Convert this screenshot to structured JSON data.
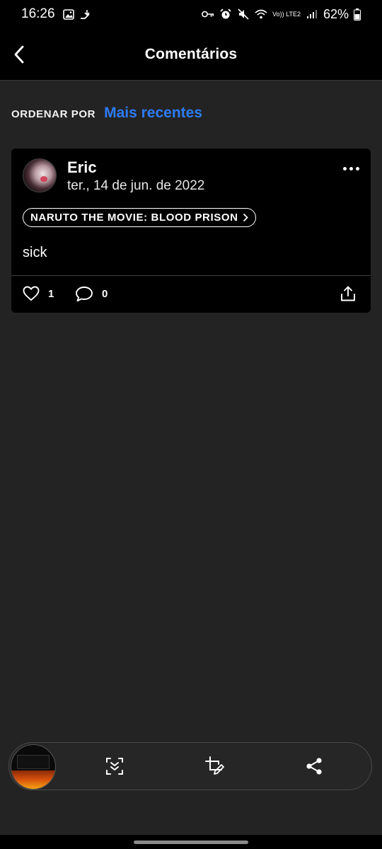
{
  "status_bar": {
    "time": "16:26",
    "battery_text": "62%",
    "network_text": "Vo)) LTE2",
    "left_icons": [
      "gallery-icon",
      "data-transfer-icon"
    ],
    "right_icons": [
      "key-icon",
      "alarm-icon",
      "mute-icon",
      "wifi-icon",
      "signal-icon",
      "battery-icon"
    ]
  },
  "header": {
    "title": "Comentários",
    "back_icon": "chevron-left-icon"
  },
  "sort": {
    "label": "ORDENAR POR",
    "value": "Mais recentes",
    "accent_color": "#2d7cf6"
  },
  "comment": {
    "author": "Eric",
    "date": "ter., 14 de jun. de 2022",
    "title_chip": "NARUTO THE MOVIE: BLOOD PRISON",
    "text": "sick",
    "likes": "1",
    "replies": "0",
    "icons": [
      "more-icon",
      "heart-icon",
      "speech-bubble-icon",
      "share-upload-icon"
    ]
  },
  "capture_toolbar": {
    "icons": [
      "scroll-capture-icon",
      "crop-edit-icon",
      "share-icon"
    ]
  },
  "colors": {
    "background": "#232323",
    "header": "#000000",
    "card": "#000000",
    "accent": "#2d7cf6"
  }
}
